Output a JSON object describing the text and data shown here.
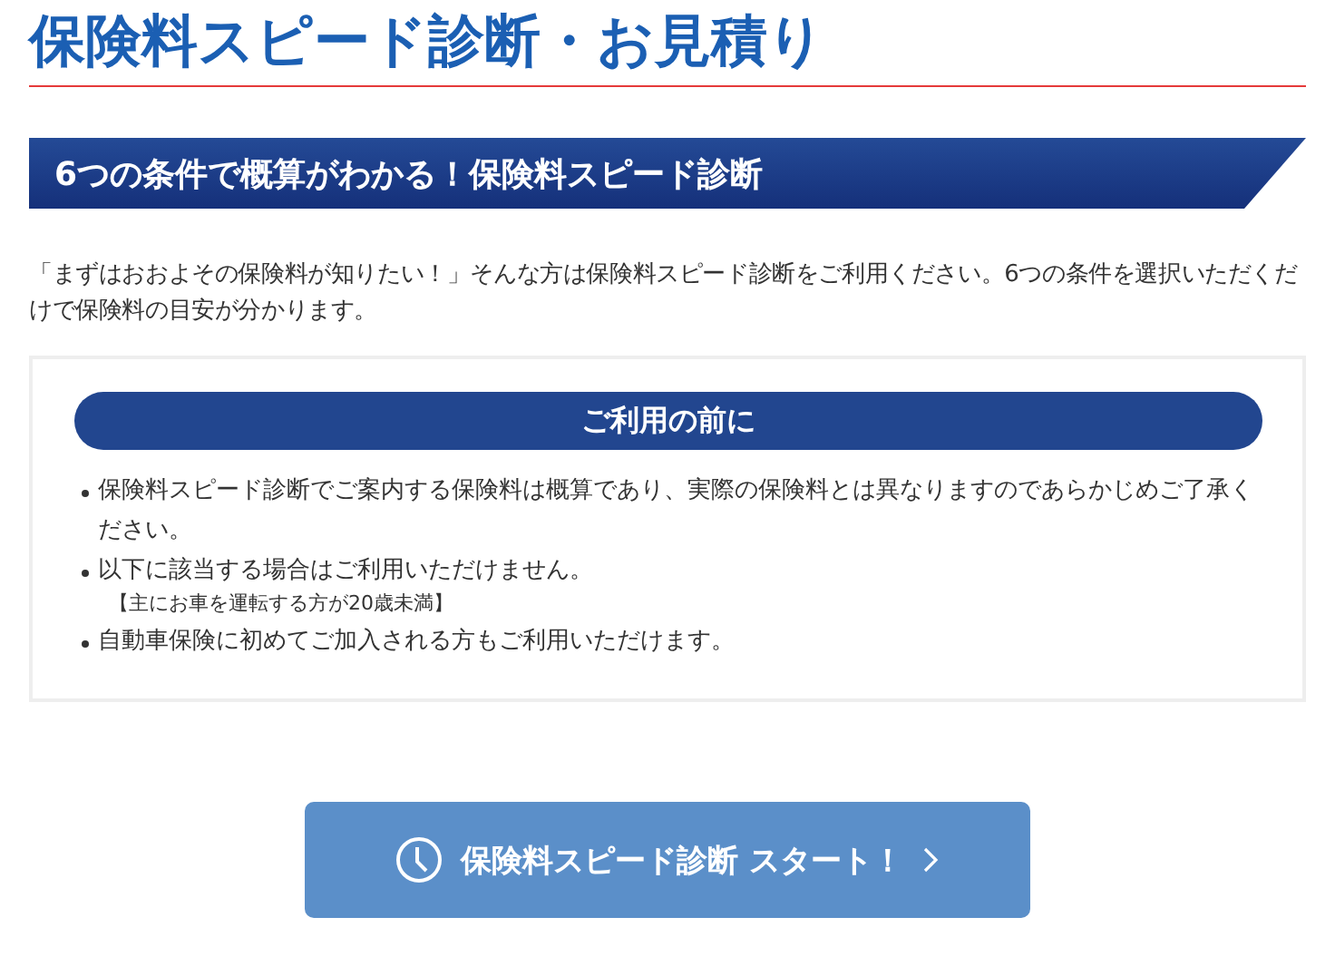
{
  "page_title": "保険料スピード診断・お見積り",
  "section_heading": "6つの条件で概算がわかる！保険料スピード診断",
  "intro": "「まずはおおよその保険料が知りたい！」そんな方は保険料スピード診断をご利用ください。6つの条件を選択いただくだけで保険料の目安が分かります。",
  "notice": {
    "title": "ご利用の前に",
    "items": [
      {
        "text": "保険料スピード診断でご案内する保険料は概算であり、実際の保険料とは異なりますのであらかじめご了承ください。"
      },
      {
        "text": "以下に該当する場合はご利用いただけません。",
        "note": "【主にお車を運転する方が20歳未満】"
      },
      {
        "text": "自動車保険に初めてご加入される方もご利用いただけます。"
      }
    ]
  },
  "start_button": {
    "label": "保険料スピード診断 スタート！"
  }
}
